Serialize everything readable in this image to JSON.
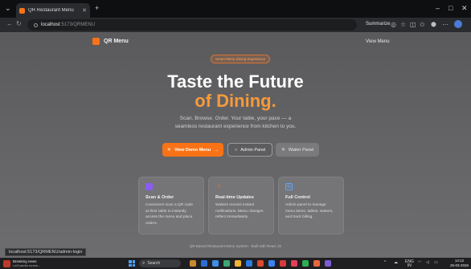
{
  "browser": {
    "tab_title": "QR Restaurant Menu",
    "url_host": "localhost",
    "url_path": ":5173/QRMENU",
    "summarize_label": "Summarize"
  },
  "site": {
    "brand": "QR Menu",
    "view_menu": "View Menu",
    "pill": "Smart Menu Dining Experience",
    "headline_line1": "Taste the Future",
    "headline_line2": "of Dining.",
    "subtitle_line1": "Scan. Browse. Order. Your table, your pace — a",
    "subtitle_line2": "seamless restaurant experience from kitchen to you.",
    "buttons": {
      "primary": "View Demo Menu",
      "admin": "Admin Panel",
      "waiter": "Waiter Panel"
    },
    "cards": [
      {
        "title": "Scan & Order",
        "lines": [
          "Customers scan a QR code",
          "at their table to instantly",
          "access the menu and place",
          "orders."
        ],
        "color": "#8b5cf6"
      },
      {
        "title": "Real-time Updates",
        "lines": [
          "Waiters receive instant",
          "notifications. Menu changes",
          "reflect immediately."
        ],
        "color": "#f97316"
      },
      {
        "title": "Full Control",
        "lines": [
          "Admin panel to manage",
          "menu items, tables, waiters,",
          "and track billing."
        ],
        "color": "#60a5fa"
      }
    ],
    "footer": "QR Based Restaurant Menu System · Built with React JS"
  },
  "status_link": "localhost:5173/QRMENU/admin-login",
  "taskbar": {
    "news_title": "Breaking news",
    "news_sub": "LaGuardia runwa...",
    "search_label": "Search",
    "lang": "ENG",
    "lang_sub": "IN",
    "time": "14:12",
    "date": "25-03-2026"
  },
  "colors": {
    "accent": "#f97316",
    "headline_accent": "#f59a3c"
  }
}
